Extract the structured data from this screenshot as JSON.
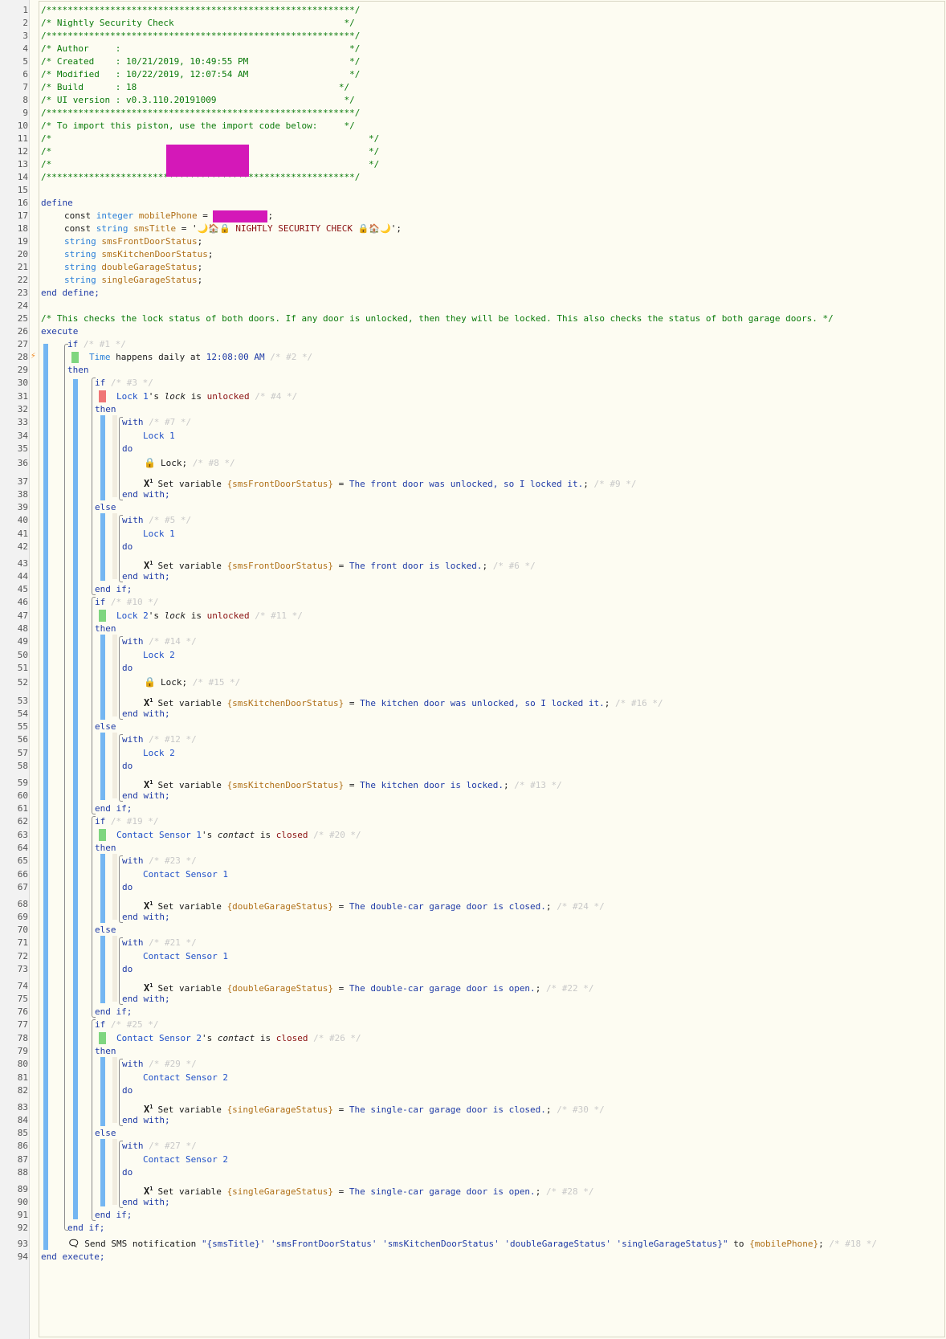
{
  "header": {
    "border": "/**********************************************************/",
    "title": "/* Nightly Security Check                                */",
    "author": "/* Author     :                                           */",
    "created": "/* Created    : 10/21/2019, 10:49:55 PM                   */",
    "modified": "/* Modified   : 10/22/2019, 12:07:54 AM                   */",
    "build": "/* Build      : 18                                      */",
    "ui_version": "/* UI version : v0.3.110.20191009                        */",
    "import_note": "/* To import this piston, use the import code below:     */",
    "import_line_start": "/*",
    "import_line_end": "*/"
  },
  "define": {
    "open": "define",
    "close": "end define;",
    "lines": [
      {
        "kw": "const",
        "type": "integer",
        "name": "mobilePhone",
        "op": " = ",
        "tail": ";"
      },
      {
        "kw": "const",
        "type": "string",
        "name": "smsTitle",
        "op": " = '",
        "value": "🌙🏠🔒 NIGHTLY SECURITY CHECK 🔒🏠🌙",
        "tail": "';"
      },
      {
        "type": "string",
        "name": "smsFrontDoorStatus",
        "tail": ";"
      },
      {
        "type": "string",
        "name": "smsKitchenDoorStatus",
        "tail": ";"
      },
      {
        "type": "string",
        "name": "doubleGarageStatus",
        "tail": ";"
      },
      {
        "type": "string",
        "name": "singleGarageStatus",
        "tail": ";"
      }
    ]
  },
  "comment_main": "/* This checks the lock status of both doors. If any door is unlocked, then they will be locked. This also checks the status of both garage doors. */",
  "keywords": {
    "execute": "execute",
    "end_execute": "end execute;",
    "if": "if",
    "then": "then",
    "else": "else",
    "end_if": "end if;",
    "with": "with",
    "do": "do",
    "end_with": "end with;",
    "set_variable": "Set variable",
    "lock_action": "Lock;",
    "is": "is",
    "possessive": "'s"
  },
  "trigger": {
    "word": "Time",
    "text": " happens daily at ",
    "value": "12:08:00 AM",
    "id": "/* #2 */"
  },
  "ids": {
    "if1": "/* #1 */",
    "if3": "/* #3 */",
    "c4": "/* #4 */",
    "w7": "/* #7 */",
    "a8": "/* #8 */",
    "s9": "/* #9 */",
    "w5": "/* #5 */",
    "s6": "/* #6 */",
    "if10": "/* #10 */",
    "c11": "/* #11 */",
    "w14": "/* #14 */",
    "a15": "/* #15 */",
    "s16": "/* #16 */",
    "w12": "/* #12 */",
    "s13": "/* #13 */",
    "if19": "/* #19 */",
    "c20": "/* #20 */",
    "w23": "/* #23 */",
    "s24": "/* #24 */",
    "w21": "/* #21 */",
    "s22": "/* #22 */",
    "if25": "/* #25 */",
    "c26": "/* #26 */",
    "w29": "/* #29 */",
    "s30": "/* #30 */",
    "w27": "/* #27 */",
    "s28": "/* #28 */",
    "n18": "/* #18 */"
  },
  "devices": {
    "lock1": "Lock 1",
    "lock2": "Lock 2",
    "cs1": "Contact Sensor 1",
    "cs2": "Contact Sensor 2"
  },
  "attributes": {
    "lock": "lock",
    "contact": "contact"
  },
  "states": {
    "unlocked": "unlocked",
    "closed": "closed"
  },
  "vars": {
    "front": "{smsFrontDoorStatus}",
    "kitchen": "{smsKitchenDoorStatus}",
    "double": "{doubleGarageStatus}",
    "single": "{singleGarageStatus}",
    "phone": "{mobilePhone}"
  },
  "values": {
    "front_unlocked": "The front door was unlocked, so I locked it.",
    "front_locked": "The front door is locked.",
    "kitchen_unlocked": "The kitchen door was unlocked, so I locked it.",
    "kitchen_locked": "The kitchen door is locked.",
    "double_closed": "The double-car garage door is closed.",
    "double_open": "The double-car garage door is open.",
    "single_closed": "The single-car garage door is closed.",
    "single_open": "The single-car garage door is open."
  },
  "sms": {
    "text": "Send SMS notification ",
    "message": "\"{smsTitle}' 'smsFrontDoorStatus' 'smsKitchenDoorStatus' 'doubleGarageStatus' 'singleGarageStatus}\"",
    "to": " to "
  },
  "line_numbers": [
    "1",
    "2",
    "3",
    "4",
    "5",
    "6",
    "7",
    "8",
    "9",
    "10",
    "11",
    "12",
    "13",
    "14",
    "15",
    "16",
    "17",
    "18",
    "19",
    "20",
    "21",
    "22",
    "23",
    "24",
    "25",
    "26",
    "27",
    "28",
    "29",
    "30",
    "31",
    "32",
    "33",
    "34",
    "35",
    "36",
    "37",
    "38",
    "39",
    "40",
    "41",
    "42",
    "43",
    "44",
    "45",
    "46",
    "47",
    "48",
    "49",
    "50",
    "51",
    "52",
    "53",
    "54",
    "55",
    "56",
    "57",
    "58",
    "59",
    "60",
    "61",
    "62",
    "63",
    "64",
    "65",
    "66",
    "67",
    "68",
    "69",
    "70",
    "71",
    "72",
    "73",
    "74",
    "75",
    "76",
    "77",
    "78",
    "79",
    "80",
    "81",
    "82",
    "83",
    "84",
    "85",
    "86",
    "87",
    "88",
    "89",
    "90",
    "91",
    "92",
    "93",
    "94"
  ],
  "colors": {
    "accent_blue": "#74b6f2",
    "condition_green": "#7fd67f",
    "condition_red": "#f07676",
    "redaction": "#d418b8"
  },
  "icons": {
    "trigger": "lightning-bolt-icon",
    "lock": "padlock-icon",
    "variable": "variable-x-icon",
    "sms": "speech-bubble-icon"
  }
}
